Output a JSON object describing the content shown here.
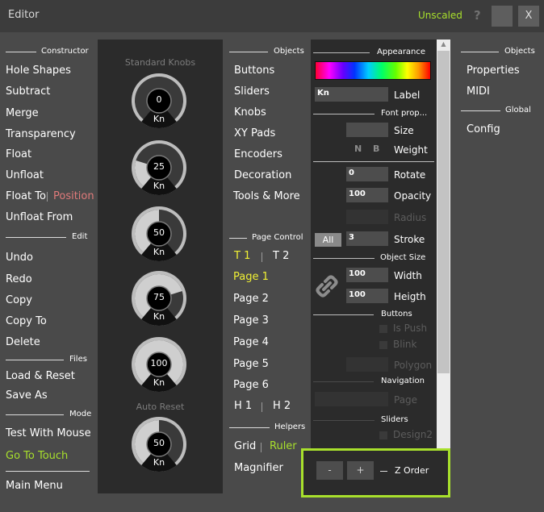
{
  "titlebar": {
    "title": "Editor",
    "unscaled": "Unscaled",
    "help": "?",
    "close": "X"
  },
  "left": {
    "constructor_header": "Constructor",
    "hole_shapes": "Hole Shapes",
    "subtract": "Subtract",
    "merge": "Merge",
    "transparency": "Transparency",
    "float": "Float",
    "unfloat": "Unfloat",
    "float_to": "Float To",
    "position": "Position",
    "unfloat_from": "Unfloat From",
    "edit_header": "Edit",
    "undo": "Undo",
    "redo": "Redo",
    "copy": "Copy",
    "copy_to": "Copy To",
    "delete": "Delete",
    "files_header": "Files",
    "load_reset": "Load & Reset",
    "save_as": "Save As",
    "mode_header": "Mode",
    "test_with_mouse": "Test With Mouse",
    "go_to_touch": "Go To Touch",
    "main_menu": "Main Menu"
  },
  "knobs": {
    "standard_label": "Standard Knobs",
    "auto_reset_label": "Auto Reset",
    "items": [
      {
        "value": "0",
        "label": "Kn",
        "level": 0
      },
      {
        "value": "25",
        "label": "Kn",
        "level": 0.25
      },
      {
        "value": "50",
        "label": "Kn",
        "level": 0.5
      },
      {
        "value": "75",
        "label": "Kn",
        "level": 0.75
      },
      {
        "value": "100",
        "label": "Kn",
        "level": 1.0
      },
      {
        "value": "50",
        "label": "Kn",
        "level": 0.5
      }
    ]
  },
  "middle": {
    "objects_header": "Objects",
    "buttons": "Buttons",
    "sliders": "Sliders",
    "knobs": "Knobs",
    "xy_pads": "XY Pads",
    "encoders": "Encoders",
    "decoration": "Decoration",
    "tools_more": "Tools & More",
    "page_control_header": "Page Control",
    "t1": "T 1",
    "t2": "T 2",
    "page1": "Page 1",
    "page2": "Page 2",
    "page3": "Page 3",
    "page4": "Page 4",
    "page5": "Page 5",
    "page6": "Page 6",
    "h1": "H 1",
    "h2": "H 2",
    "helpers_header": "Helpers",
    "grid": "Grid",
    "ruler": "Ruler",
    "magnifier": "Magnifier"
  },
  "props": {
    "appearance_header": "Appearance",
    "label_value": "Kn",
    "label_caption": "Label",
    "font_header": "Font prop...",
    "size_caption": "Size",
    "font_n": "N",
    "font_b": "B",
    "weight_caption": "Weight",
    "rotate_value": "0",
    "rotate_caption": "Rotate",
    "opacity_value": "100",
    "opacity_caption": "Opacity",
    "radius_caption": "Radius",
    "all_button": "All",
    "stroke_value": "3",
    "stroke_caption": "Stroke",
    "object_size_header": "Object Size",
    "width_value": "100",
    "width_caption": "Width",
    "height_value": "100",
    "height_caption": "Heigth",
    "buttons_header": "Buttons",
    "is_push": "Is Push",
    "blink": "Blink",
    "polygon": "Polygon",
    "navigation_header": "Navigation",
    "page_caption": "Page",
    "sliders_header": "Sliders",
    "design2": "Design2"
  },
  "zorder": {
    "minus": "-",
    "plus": "+",
    "label": "Z Order"
  },
  "right": {
    "objects_header": "Objects",
    "properties": "Properties",
    "midi": "MIDI",
    "global_header": "Global",
    "config": "Config"
  },
  "colors": {
    "accent_green": "#a8e02c",
    "active_yellow": "#f0f034",
    "position_red": "#e07a7a",
    "panel_bg": "#2b2b2b",
    "window_bg": "#4a4a4a"
  },
  "icons": {
    "link": "chain-link-icon",
    "scroll_up": "chevron-up-icon",
    "scroll_down": "chevron-down-icon"
  }
}
